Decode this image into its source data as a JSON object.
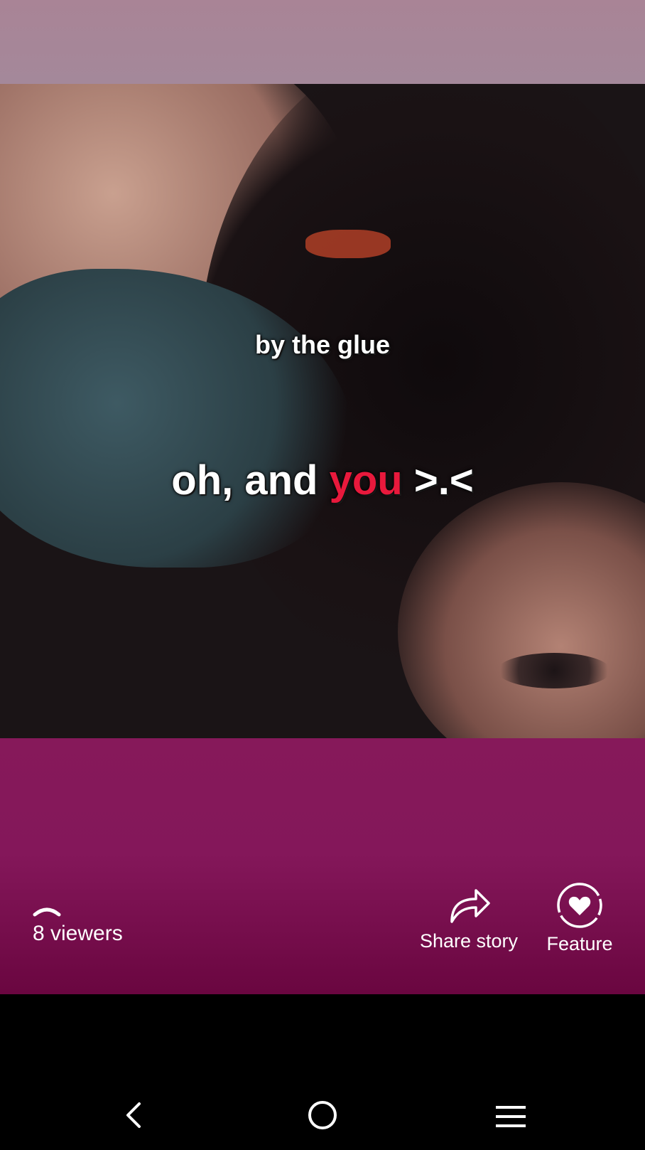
{
  "story": {
    "caption_top": "by the glue",
    "caption_main_parts": [
      "oh, and ",
      "you",
      " >.<"
    ],
    "highlight_color": "#e8193c"
  },
  "footer": {
    "viewers_label": "8 viewers",
    "share_label": "Share story",
    "feature_label": "Feature"
  },
  "icons": {
    "viewers": "chevron-up-icon",
    "share": "share-arrow-icon",
    "feature": "feature-heart-icon",
    "nav_back": "back-icon",
    "nav_home": "home-icon",
    "nav_menu": "menu-icon"
  }
}
